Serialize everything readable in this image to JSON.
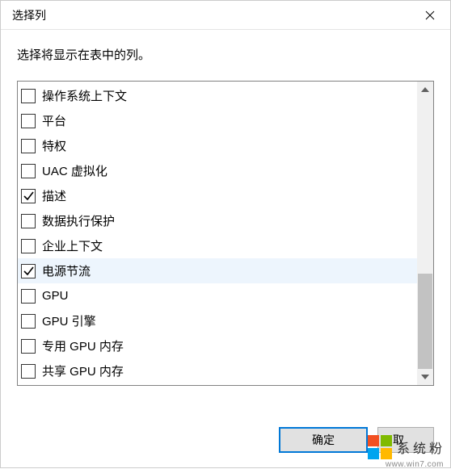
{
  "dialog": {
    "title": "选择列",
    "instruction": "选择将显示在表中的列。",
    "ok_label": "确定",
    "cancel_label": "取"
  },
  "columns": [
    {
      "label": "操作系统上下文",
      "checked": false,
      "selected": false
    },
    {
      "label": "平台",
      "checked": false,
      "selected": false
    },
    {
      "label": "特权",
      "checked": false,
      "selected": false
    },
    {
      "label": "UAC 虚拟化",
      "checked": false,
      "selected": false
    },
    {
      "label": "描述",
      "checked": true,
      "selected": false
    },
    {
      "label": "数据执行保护",
      "checked": false,
      "selected": false
    },
    {
      "label": "企业上下文",
      "checked": false,
      "selected": false
    },
    {
      "label": "电源节流",
      "checked": true,
      "selected": true
    },
    {
      "label": "GPU",
      "checked": false,
      "selected": false
    },
    {
      "label": "GPU 引擎",
      "checked": false,
      "selected": false
    },
    {
      "label": "专用 GPU 内存",
      "checked": false,
      "selected": false
    },
    {
      "label": "共享 GPU 内存",
      "checked": false,
      "selected": false
    }
  ],
  "watermark": {
    "text": "系统粉",
    "url": "www.win7.com"
  }
}
